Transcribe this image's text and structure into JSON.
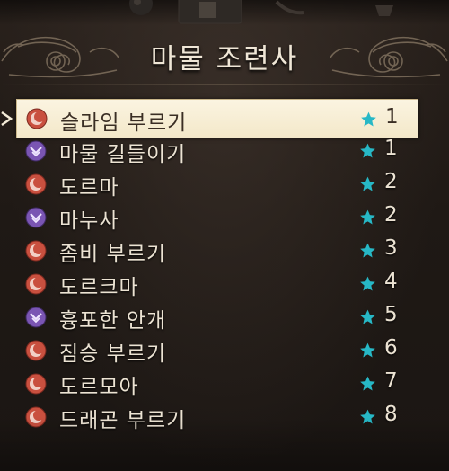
{
  "window": {
    "title": "마물 조련사"
  },
  "colors": {
    "selected_bg": "#f6ecd1",
    "star": "#2ec3cf",
    "red_orb": "#c24a3e",
    "purple_orb": "#7b56b0",
    "text": "#ece3d3"
  },
  "skills": [
    {
      "name": "슬라임 부르기",
      "level": "1",
      "icon": "red-crescent-icon",
      "selected": true
    },
    {
      "name": "마물 길들이기",
      "level": "1",
      "icon": "purple-chevron-icon"
    },
    {
      "name": "도르마",
      "level": "2",
      "icon": "red-crescent-icon"
    },
    {
      "name": "마누사",
      "level": "2",
      "icon": "purple-chevron-icon"
    },
    {
      "name": "좀비 부르기",
      "level": "3",
      "icon": "red-crescent-icon"
    },
    {
      "name": "도르크마",
      "level": "4",
      "icon": "red-crescent-icon"
    },
    {
      "name": "흉포한 안개",
      "level": "5",
      "icon": "purple-chevron-icon"
    },
    {
      "name": "짐승 부르기",
      "level": "6",
      "icon": "red-crescent-icon"
    },
    {
      "name": "도르모아",
      "level": "7",
      "icon": "red-crescent-icon"
    },
    {
      "name": "드래곤 부르기",
      "level": "8",
      "icon": "red-crescent-icon"
    }
  ]
}
